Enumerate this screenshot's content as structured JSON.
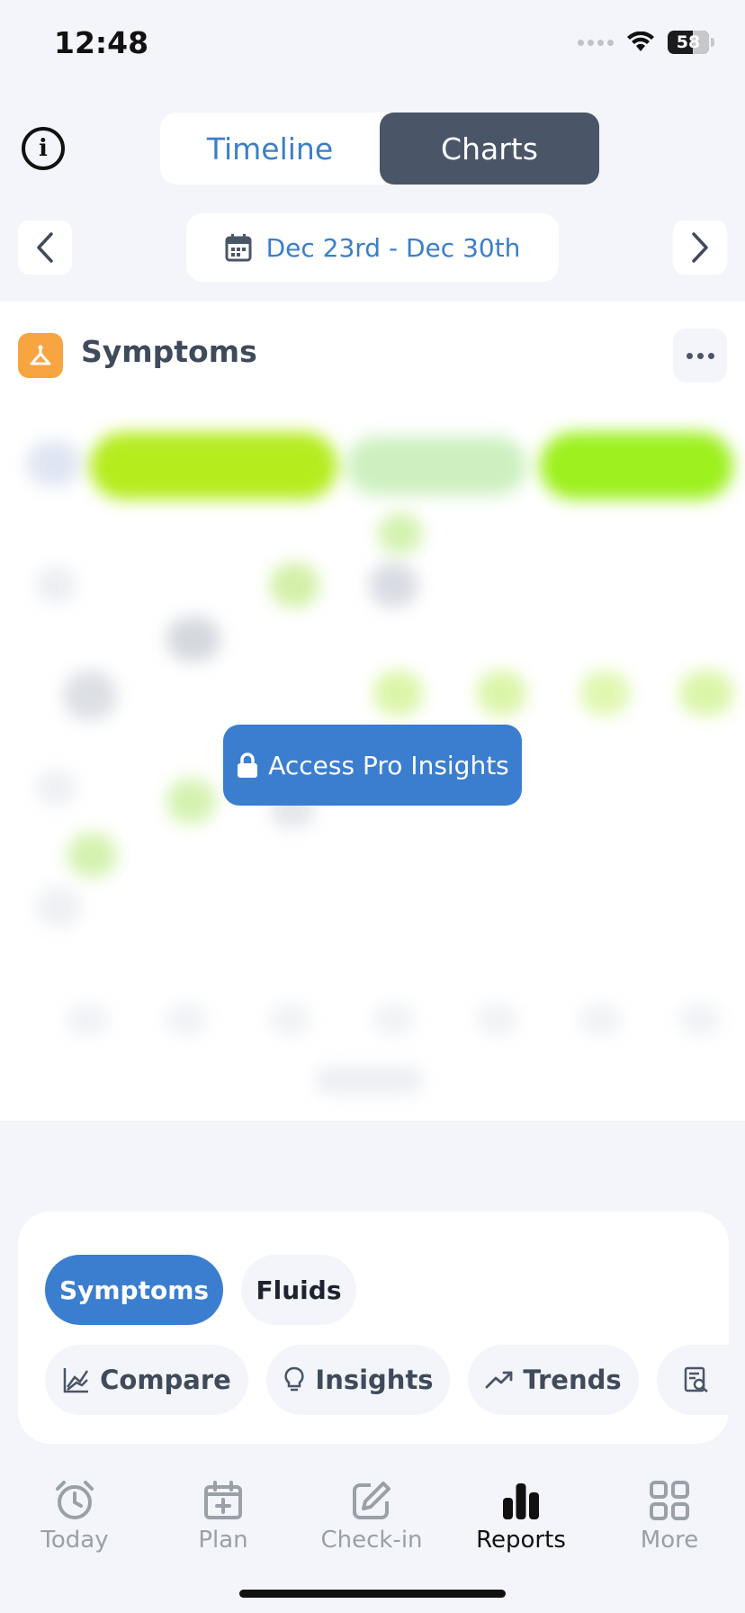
{
  "status": {
    "time": "12:48",
    "battery": "58"
  },
  "top": {
    "info_icon": "info-circle-icon",
    "tabs": [
      {
        "label": "Timeline",
        "active": false
      },
      {
        "label": "Charts",
        "active": true
      }
    ]
  },
  "date_nav": {
    "range": "Dec 23rd - Dec 30th"
  },
  "panel": {
    "title": "Symptoms",
    "cta_label": "Access Pro Insights"
  },
  "filters": {
    "categories": [
      {
        "label": "Symptoms",
        "selected": true
      },
      {
        "label": "Fluids",
        "selected": false
      }
    ],
    "actions": [
      {
        "label": "Compare",
        "icon": "compare-chart-icon"
      },
      {
        "label": "Insights",
        "icon": "lightbulb-icon"
      },
      {
        "label": "Trends",
        "icon": "trend-up-icon"
      }
    ]
  },
  "tabbar": {
    "items": [
      {
        "label": "Today",
        "icon": "alarm-clock-icon",
        "active": false
      },
      {
        "label": "Plan",
        "icon": "calendar-plus-icon",
        "active": false
      },
      {
        "label": "Check-in",
        "icon": "edit-square-icon",
        "active": false
      },
      {
        "label": "Reports",
        "icon": "bar-chart-icon",
        "active": true
      },
      {
        "label": "More",
        "icon": "grid-icon",
        "active": false
      }
    ]
  },
  "colors": {
    "accent": "#3b7ecf",
    "active_segment": "#4a5568",
    "symptom_icon": "#f6a540",
    "blur_green": "#a6e622"
  }
}
